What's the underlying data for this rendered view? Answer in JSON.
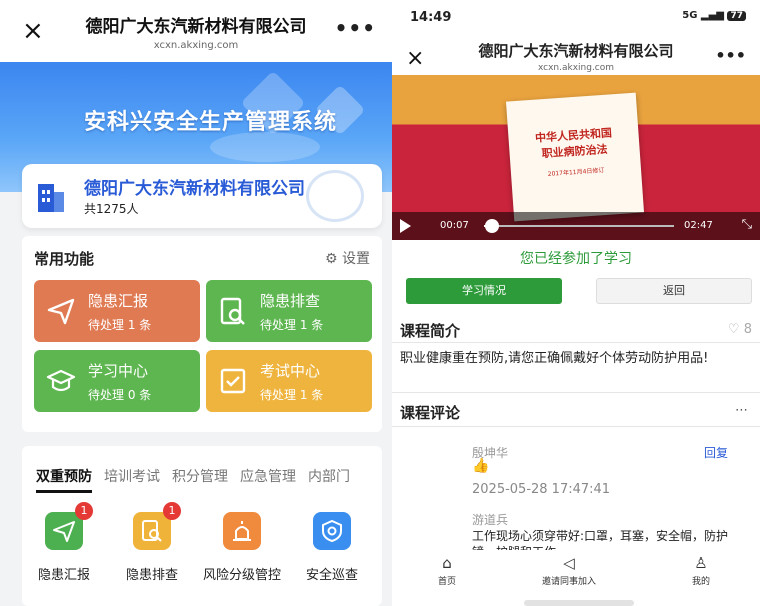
{
  "left_screen": {
    "navbar": {
      "title": "德阳广大东汽新材料有限公司",
      "subtitle": "xcxn.akxing.com",
      "close": "×",
      "more": "•••"
    },
    "banner": {
      "title": "安科兴安全生产管理系统"
    },
    "company": {
      "name": "德阳广大东汽新材料有限公司",
      "count": "共1275人"
    },
    "functions": {
      "title": "常用功能",
      "settings": "设置",
      "tiles": [
        {
          "name": "隐患汇报",
          "sub": "待处理 1 条",
          "color": "#e07a53"
        },
        {
          "name": "隐患排查",
          "sub": "待处理 1 条",
          "color": "#5db64f"
        },
        {
          "name": "学习中心",
          "sub": "待处理 0 条",
          "color": "#5db64f"
        },
        {
          "name": "考试中心",
          "sub": "待处理 1 条",
          "color": "#efb43e"
        }
      ]
    },
    "tabs": [
      "双重预防",
      "培训考试",
      "积分管理",
      "应急管理",
      "内部门"
    ],
    "quick": [
      {
        "label": "隐患汇报",
        "badge": "1",
        "color": "#4caf50"
      },
      {
        "label": "隐患排查",
        "badge": "1",
        "color": "#f0b33a"
      },
      {
        "label": "风险分级管控",
        "badge": "",
        "color": "#f08a3c"
      },
      {
        "label": "安全巡查",
        "badge": "",
        "color": "#3a8ef0"
      }
    ]
  },
  "right_screen": {
    "status": {
      "time": "14:49",
      "signal": "5G",
      "battery": "77"
    },
    "navbar": {
      "title": "德阳广大东汽新材料有限公司",
      "subtitle": "xcxn.akxing.com",
      "close": "×",
      "more": "•••"
    },
    "video": {
      "doc_line1": "中华人民共和国",
      "doc_line2": "职业病防治法",
      "doc_line3": "2017年11月4日修订",
      "current": "00:07",
      "duration": "02:47",
      "progress": 0.04
    },
    "joined_text": "您已经参加了学习",
    "btn_study": "学习情况",
    "btn_back": "返回",
    "intro_title": "课程简介",
    "likes": "8",
    "intro_text": "职业健康重在预防,请您正确佩戴好个体劳动防护用品!",
    "comments_title": "课程评论",
    "comments": [
      {
        "author": "殷坤华",
        "reply": "回复",
        "emoji": "👍",
        "time": "2025-05-28 17:47:41"
      },
      {
        "author": "游道兵",
        "text": "工作现场心须穿带好:口罩，耳塞，安全帽，防护镜，护腿和工作"
      }
    ],
    "tabbar": [
      {
        "icon": "⌂",
        "label": "首页"
      },
      {
        "icon": "◁",
        "label": "邀请同事加入"
      },
      {
        "icon": "♙",
        "label": "我的"
      }
    ]
  }
}
